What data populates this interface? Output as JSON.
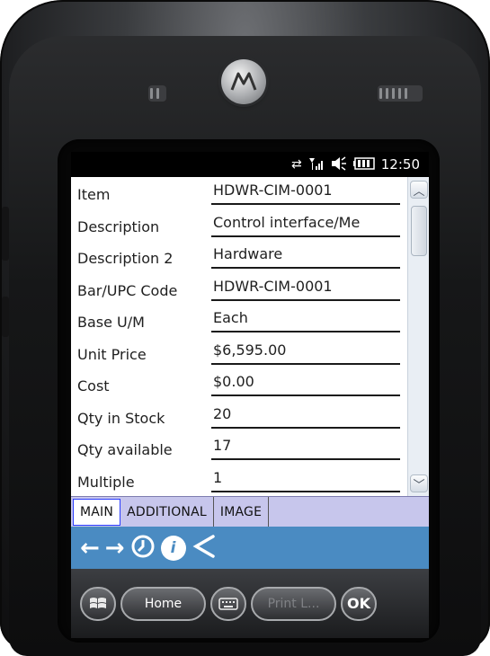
{
  "device": {
    "brand_logo_letter": "M"
  },
  "status": {
    "time": "12:50"
  },
  "form": {
    "fields": [
      {
        "label": "Item",
        "value": "HDWR-CIM-0001"
      },
      {
        "label": "Description",
        "value": "Control interface/Me"
      },
      {
        "label": "Description 2",
        "value": "Hardware"
      },
      {
        "label": "Bar/UPC Code",
        "value": "HDWR-CIM-0001"
      },
      {
        "label": "Base U/M",
        "value": "Each"
      },
      {
        "label": "Unit Price",
        "value": "$6,595.00"
      },
      {
        "label": "Cost",
        "value": "$0.00"
      },
      {
        "label": "Qty in Stock",
        "value": "20"
      },
      {
        "label": "Qty available",
        "value": "17"
      },
      {
        "label": "Multiple",
        "value": "1"
      }
    ]
  },
  "tabs": [
    "MAIN",
    "ADDITIONAL",
    "IMAGE"
  ],
  "softkeys": {
    "home": "Home",
    "print": "Print L...",
    "ok": "OK"
  },
  "colors": {
    "toolbar": "#4a8bc2",
    "tabbar": "#c7c6ec"
  }
}
